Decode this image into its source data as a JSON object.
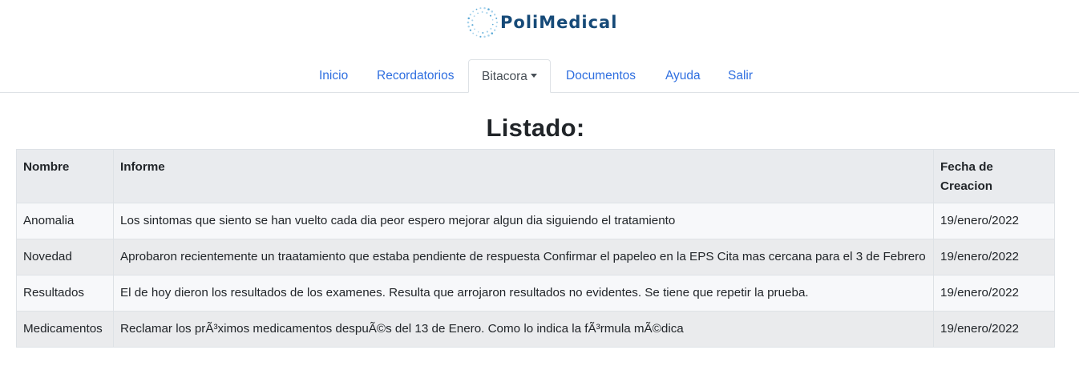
{
  "brand": {
    "name": "PoliMedical",
    "logo_icon": "dotted-circle-logo"
  },
  "nav": {
    "items": [
      {
        "label": "Inicio"
      },
      {
        "label": "Recordatorios"
      },
      {
        "label": "Bitacora",
        "active": true,
        "dropdown": true
      },
      {
        "label": "Documentos"
      },
      {
        "label": "Ayuda"
      },
      {
        "label": "Salir"
      }
    ]
  },
  "page": {
    "title": "Listado:"
  },
  "table": {
    "headers": [
      "Nombre",
      "Informe",
      "Fecha de Creacion"
    ],
    "rows": [
      [
        "Anomalia",
        "Los sintomas que siento se han vuelto cada dia peor espero mejorar algun dia siguiendo el tratamiento",
        "19/enero/2022"
      ],
      [
        "Novedad",
        "Aprobaron recientemente un traatamiento que estaba pendiente de respuesta Confirmar el papeleo en la EPS Cita mas cercana para el 3 de Febrero",
        "19/enero/2022"
      ],
      [
        "Resultados",
        "El de hoy dieron los resultados de los examenes. Resulta que arrojaron resultados no evidentes. Se tiene que repetir la prueba.",
        "19/enero/2022"
      ],
      [
        "Medicamentos",
        "Reclamar los prÃ³ximos medicamentos despuÃ©s del 13 de Enero. Como lo indica la fÃ³rmula mÃ©dica",
        "19/enero/2022"
      ]
    ]
  },
  "colors": {
    "brand": "#164a78",
    "link": "#2f6fe0",
    "border": "#dee2e6"
  }
}
